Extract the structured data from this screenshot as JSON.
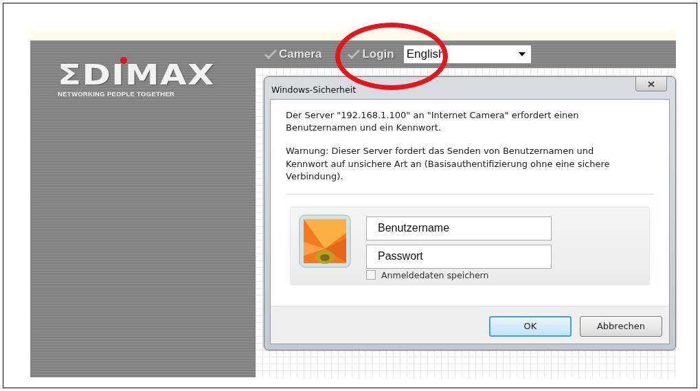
{
  "logo": {
    "brand": "ΣDIMAX",
    "tagline": "NETWORKING PEOPLE TOGETHER"
  },
  "nav": {
    "items": [
      {
        "label": "Camera"
      },
      {
        "label": "Login"
      }
    ],
    "language": {
      "value": "English"
    }
  },
  "dialog": {
    "title": "Windows-Sicherheit",
    "message": "Der Server \"192.168.1.100\" an \"Internet Camera\" erfordert einen Benutzernamen und ein Kennwort.",
    "warning": "Warnung: Dieser Server fordert das Senden von Benutzernamen und Kennwort auf unsichere Art an (Basisauthentifizierung ohne eine sichere Verbindung).",
    "fields": [
      {
        "placeholder": "Benutzername"
      },
      {
        "placeholder": "Passwort"
      }
    ],
    "remember": {
      "label": "Anmeldedaten speichern",
      "checked": false
    },
    "buttons": [
      {
        "label": "OK",
        "default": true
      },
      {
        "label": "Abbrechen",
        "default": false
      }
    ]
  }
}
